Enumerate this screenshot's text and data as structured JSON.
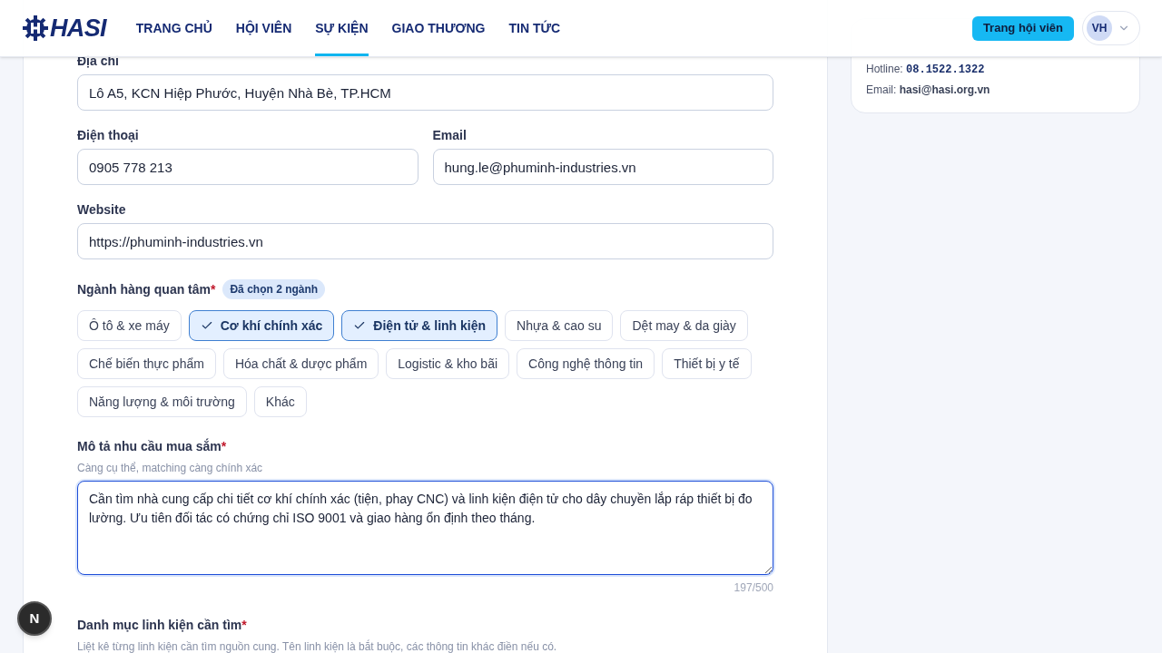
{
  "header": {
    "logo_text": "HASI",
    "nav": [
      {
        "label": "TRANG CHỦ",
        "selected": false
      },
      {
        "label": "HỘI VIÊN",
        "selected": false
      },
      {
        "label": "SỰ KIỆN",
        "selected": true
      },
      {
        "label": "GIAO THƯƠNG",
        "selected": false
      },
      {
        "label": "TIN TỨC",
        "selected": false
      }
    ],
    "member_button": "Trang hội viên",
    "avatar_initials": "VH"
  },
  "form": {
    "address": {
      "label": "Địa chỉ",
      "value": "Lô A5, KCN Hiệp Phước, Huyện Nhà Bè, TP.HCM"
    },
    "phone": {
      "label": "Điện thoại",
      "value": "0905 778 213"
    },
    "email": {
      "label": "Email",
      "value": "hung.le@phuminh-industries.vn"
    },
    "website": {
      "label": "Website",
      "value": "https://phuminh-industries.vn"
    },
    "industries": {
      "label": "Ngành hàng quan tâm",
      "required_mark": "*",
      "badge": "Đã chọn 2 ngành",
      "options": [
        {
          "label": "Ô tô & xe máy",
          "selected": false
        },
        {
          "label": "Cơ khí chính xác",
          "selected": true
        },
        {
          "label": "Điện tử & linh kiện",
          "selected": true
        },
        {
          "label": "Nhựa & cao su",
          "selected": false
        },
        {
          "label": "Dệt may & da giày",
          "selected": false
        },
        {
          "label": "Chế biến thực phẩm",
          "selected": false
        },
        {
          "label": "Hóa chất & dược phẩm",
          "selected": false
        },
        {
          "label": "Logistic & kho bãi",
          "selected": false
        },
        {
          "label": "Công nghệ thông tin",
          "selected": false
        },
        {
          "label": "Thiết bị y tế",
          "selected": false
        },
        {
          "label": "Năng lượng & môi trường",
          "selected": false
        },
        {
          "label": "Khác",
          "selected": false
        }
      ]
    },
    "description": {
      "label": "Mô tả nhu cầu mua sắm",
      "required_mark": "*",
      "hint": "Càng cụ thể, matching càng chính xác",
      "value": "Cần tìm nhà cung cấp chi tiết cơ khí chính xác (tiện, phay CNC) và linh kiện điện tử cho dây chuyền lắp ráp thiết bị đo lường. Ưu tiên đối tác có chứng chỉ ISO 9001 và giao hàng ổn định theo tháng.",
      "counter": "197/500"
    },
    "components": {
      "label": "Danh mục linh kiện cần tìm",
      "required_mark": "*",
      "hint": "Liệt kê từng linh kiện cần tìm nguồn cung. Tên linh kiện là bắt buộc, các thông tin khác điền nếu có."
    }
  },
  "support": {
    "hotline_label": "Hotline:",
    "hotline": "08.1522.1322",
    "email_label": "Email:",
    "email": "hasi@hasi.org.vn"
  },
  "dev_badge": "N"
}
